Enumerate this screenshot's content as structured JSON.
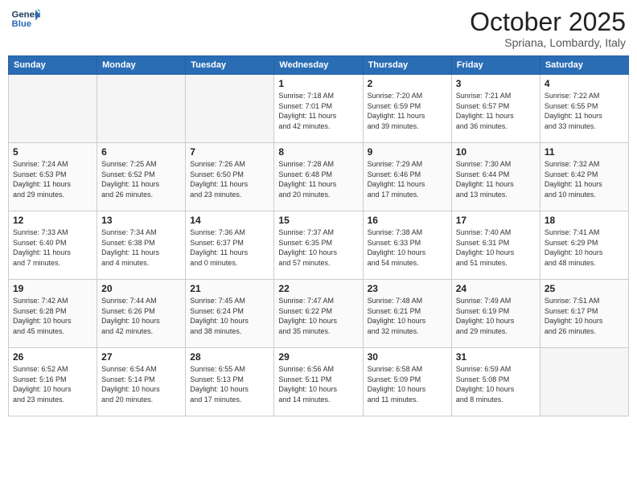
{
  "logo": {
    "line1": "General",
    "line2": "Blue"
  },
  "header": {
    "month": "October 2025",
    "location": "Spriana, Lombardy, Italy"
  },
  "weekdays": [
    "Sunday",
    "Monday",
    "Tuesday",
    "Wednesday",
    "Thursday",
    "Friday",
    "Saturday"
  ],
  "weeks": [
    [
      {
        "day": "",
        "info": ""
      },
      {
        "day": "",
        "info": ""
      },
      {
        "day": "",
        "info": ""
      },
      {
        "day": "1",
        "info": "Sunrise: 7:18 AM\nSunset: 7:01 PM\nDaylight: 11 hours\nand 42 minutes."
      },
      {
        "day": "2",
        "info": "Sunrise: 7:20 AM\nSunset: 6:59 PM\nDaylight: 11 hours\nand 39 minutes."
      },
      {
        "day": "3",
        "info": "Sunrise: 7:21 AM\nSunset: 6:57 PM\nDaylight: 11 hours\nand 36 minutes."
      },
      {
        "day": "4",
        "info": "Sunrise: 7:22 AM\nSunset: 6:55 PM\nDaylight: 11 hours\nand 33 minutes."
      }
    ],
    [
      {
        "day": "5",
        "info": "Sunrise: 7:24 AM\nSunset: 6:53 PM\nDaylight: 11 hours\nand 29 minutes."
      },
      {
        "day": "6",
        "info": "Sunrise: 7:25 AM\nSunset: 6:52 PM\nDaylight: 11 hours\nand 26 minutes."
      },
      {
        "day": "7",
        "info": "Sunrise: 7:26 AM\nSunset: 6:50 PM\nDaylight: 11 hours\nand 23 minutes."
      },
      {
        "day": "8",
        "info": "Sunrise: 7:28 AM\nSunset: 6:48 PM\nDaylight: 11 hours\nand 20 minutes."
      },
      {
        "day": "9",
        "info": "Sunrise: 7:29 AM\nSunset: 6:46 PM\nDaylight: 11 hours\nand 17 minutes."
      },
      {
        "day": "10",
        "info": "Sunrise: 7:30 AM\nSunset: 6:44 PM\nDaylight: 11 hours\nand 13 minutes."
      },
      {
        "day": "11",
        "info": "Sunrise: 7:32 AM\nSunset: 6:42 PM\nDaylight: 11 hours\nand 10 minutes."
      }
    ],
    [
      {
        "day": "12",
        "info": "Sunrise: 7:33 AM\nSunset: 6:40 PM\nDaylight: 11 hours\nand 7 minutes."
      },
      {
        "day": "13",
        "info": "Sunrise: 7:34 AM\nSunset: 6:38 PM\nDaylight: 11 hours\nand 4 minutes."
      },
      {
        "day": "14",
        "info": "Sunrise: 7:36 AM\nSunset: 6:37 PM\nDaylight: 11 hours\nand 0 minutes."
      },
      {
        "day": "15",
        "info": "Sunrise: 7:37 AM\nSunset: 6:35 PM\nDaylight: 10 hours\nand 57 minutes."
      },
      {
        "day": "16",
        "info": "Sunrise: 7:38 AM\nSunset: 6:33 PM\nDaylight: 10 hours\nand 54 minutes."
      },
      {
        "day": "17",
        "info": "Sunrise: 7:40 AM\nSunset: 6:31 PM\nDaylight: 10 hours\nand 51 minutes."
      },
      {
        "day": "18",
        "info": "Sunrise: 7:41 AM\nSunset: 6:29 PM\nDaylight: 10 hours\nand 48 minutes."
      }
    ],
    [
      {
        "day": "19",
        "info": "Sunrise: 7:42 AM\nSunset: 6:28 PM\nDaylight: 10 hours\nand 45 minutes."
      },
      {
        "day": "20",
        "info": "Sunrise: 7:44 AM\nSunset: 6:26 PM\nDaylight: 10 hours\nand 42 minutes."
      },
      {
        "day": "21",
        "info": "Sunrise: 7:45 AM\nSunset: 6:24 PM\nDaylight: 10 hours\nand 38 minutes."
      },
      {
        "day": "22",
        "info": "Sunrise: 7:47 AM\nSunset: 6:22 PM\nDaylight: 10 hours\nand 35 minutes."
      },
      {
        "day": "23",
        "info": "Sunrise: 7:48 AM\nSunset: 6:21 PM\nDaylight: 10 hours\nand 32 minutes."
      },
      {
        "day": "24",
        "info": "Sunrise: 7:49 AM\nSunset: 6:19 PM\nDaylight: 10 hours\nand 29 minutes."
      },
      {
        "day": "25",
        "info": "Sunrise: 7:51 AM\nSunset: 6:17 PM\nDaylight: 10 hours\nand 26 minutes."
      }
    ],
    [
      {
        "day": "26",
        "info": "Sunrise: 6:52 AM\nSunset: 5:16 PM\nDaylight: 10 hours\nand 23 minutes."
      },
      {
        "day": "27",
        "info": "Sunrise: 6:54 AM\nSunset: 5:14 PM\nDaylight: 10 hours\nand 20 minutes."
      },
      {
        "day": "28",
        "info": "Sunrise: 6:55 AM\nSunset: 5:13 PM\nDaylight: 10 hours\nand 17 minutes."
      },
      {
        "day": "29",
        "info": "Sunrise: 6:56 AM\nSunset: 5:11 PM\nDaylight: 10 hours\nand 14 minutes."
      },
      {
        "day": "30",
        "info": "Sunrise: 6:58 AM\nSunset: 5:09 PM\nDaylight: 10 hours\nand 11 minutes."
      },
      {
        "day": "31",
        "info": "Sunrise: 6:59 AM\nSunset: 5:08 PM\nDaylight: 10 hours\nand 8 minutes."
      },
      {
        "day": "",
        "info": ""
      }
    ]
  ]
}
